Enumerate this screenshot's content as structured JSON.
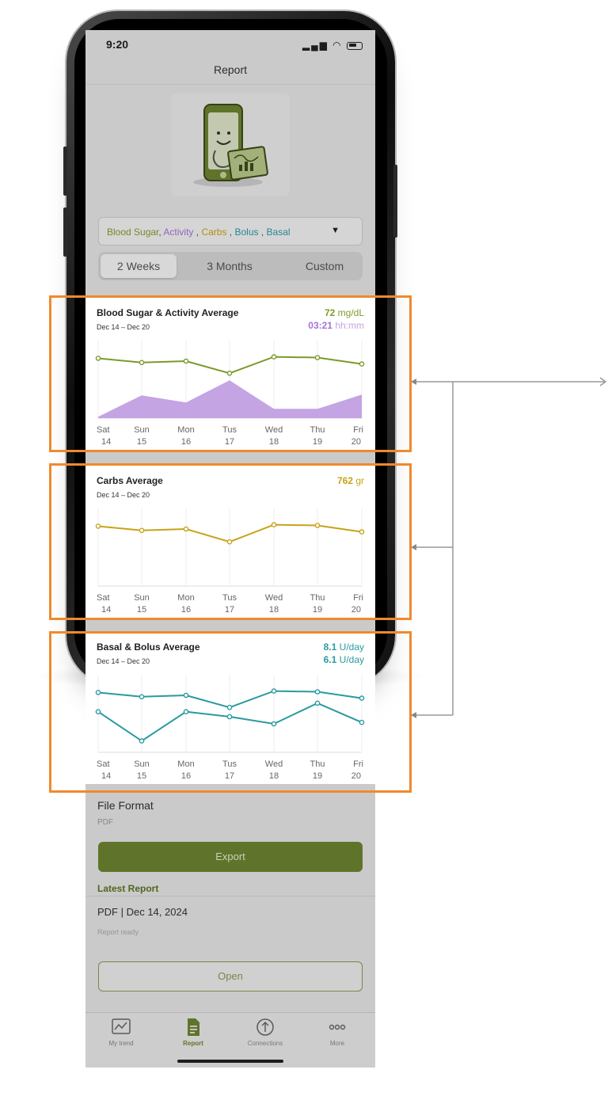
{
  "status": {
    "time": "9:20"
  },
  "nav": {
    "title": "Report"
  },
  "selector": {
    "items": [
      {
        "label": "Blood Sugar",
        "color": "#8a9a2e"
      },
      {
        "label": ", ",
        "color": "#555555"
      },
      {
        "label": "Activity",
        "color": "#a673d6"
      },
      {
        "label": " , ",
        "color": "#555555"
      },
      {
        "label": "Carbs",
        "color": "#c9a21a"
      },
      {
        "label": " , ",
        "color": "#555555"
      },
      {
        "label": "Bolus",
        "color": "#2a9aa8"
      },
      {
        "label": " , ",
        "color": "#555555"
      },
      {
        "label": "Basal",
        "color": "#2a9aa8"
      }
    ],
    "arrow": "▼"
  },
  "range_tabs": [
    "2 Weeks",
    "3 Months",
    "Custom"
  ],
  "cards": {
    "blood_sugar": {
      "title": "Blood Sugar & Activity Average",
      "date": "Dec 14 – Dec 20",
      "metric1_value": "72",
      "metric1_unit": " mg/dL",
      "metric2_value": "03:21",
      "metric2_unit": " hh:mm"
    },
    "carbs": {
      "title": "Carbs Average",
      "date": "Dec 14 – Dec 20",
      "metric1_value": "762",
      "metric1_unit": " gr"
    },
    "basal_bolus": {
      "title": "Basal & Bolus Average",
      "date": "Dec 14 – Dec 20",
      "metric1_value": "8.1",
      "metric1_unit": " U/day",
      "metric2_value": "6.1",
      "metric2_unit": " U/day"
    }
  },
  "chart_data": [
    {
      "type": "line",
      "categories": [
        "Sat 14",
        "Sun 15",
        "Mon 16",
        "Tus 17",
        "Wed 18",
        "Thu 19",
        "Fri 20"
      ],
      "day_labels": [
        "Sat",
        "Sun",
        "Mon",
        "Tus",
        "Wed",
        "Thu",
        "Fri"
      ],
      "date_labels": [
        "14",
        "15",
        "16",
        "17",
        "18",
        "19",
        "20"
      ],
      "series": [
        {
          "type": "line",
          "color": "#7d9a2a",
          "values": [
            84,
            78,
            80,
            63,
            86,
            85,
            76
          ]
        },
        {
          "type": "area",
          "color": "#c4a4e3",
          "values": [
            2,
            32,
            22,
            53,
            13,
            13,
            33
          ]
        }
      ],
      "ylim": [
        0,
        100
      ]
    },
    {
      "type": "line",
      "categories": [
        "Sat 14",
        "Sun 15",
        "Mon 16",
        "Tus 17",
        "Wed 18",
        "Thu 19",
        "Fri 20"
      ],
      "day_labels": [
        "Sat",
        "Sun",
        "Mon",
        "Tus",
        "Wed",
        "Thu",
        "Fri"
      ],
      "date_labels": [
        "14",
        "15",
        "16",
        "17",
        "18",
        "19",
        "20"
      ],
      "series": [
        {
          "type": "line",
          "color": "#c9a21a",
          "values": [
            84,
            78,
            80,
            62,
            86,
            85,
            76
          ]
        }
      ],
      "ylim": [
        0,
        100
      ]
    },
    {
      "type": "line",
      "categories": [
        "Sat 14",
        "Sun 15",
        "Mon 16",
        "Tus 17",
        "Wed 18",
        "Thu 19",
        "Fri 20"
      ],
      "day_labels": [
        "Sat",
        "Sun",
        "Mon",
        "Tus",
        "Wed",
        "Thu",
        "Fri"
      ],
      "date_labels": [
        "14",
        "15",
        "16",
        "17",
        "18",
        "19",
        "20"
      ],
      "series": [
        {
          "type": "line",
          "color": "#2a9aa0",
          "values": [
            84,
            78,
            80,
            63,
            86,
            85,
            76
          ]
        },
        {
          "type": "line",
          "color": "#2a9aa0",
          "values": [
            57,
            16,
            57,
            50,
            40,
            69,
            42
          ]
        }
      ],
      "ylim": [
        0,
        100
      ]
    }
  ],
  "file_format": {
    "label": "File Format",
    "value": "PDF"
  },
  "export": {
    "label": "Export"
  },
  "latest": {
    "heading": "Latest  Report",
    "file": "PDF | Dec 14, 2024",
    "status": "Report ready"
  },
  "open": {
    "label": "Open"
  },
  "tabbar": [
    {
      "label": "My trend",
      "icon": "trend-icon"
    },
    {
      "label": "Report",
      "icon": "report-icon"
    },
    {
      "label": "Connections",
      "icon": "connections-icon"
    },
    {
      "label": "More",
      "icon": "more-icon"
    }
  ],
  "colors": {
    "accent": "#6d8530",
    "highlight": "#ef8a2e",
    "blood_sugar": "#7d9a2a",
    "activity": "#a673d6",
    "carbs": "#c9a21a",
    "insulin": "#2a9aa0"
  }
}
